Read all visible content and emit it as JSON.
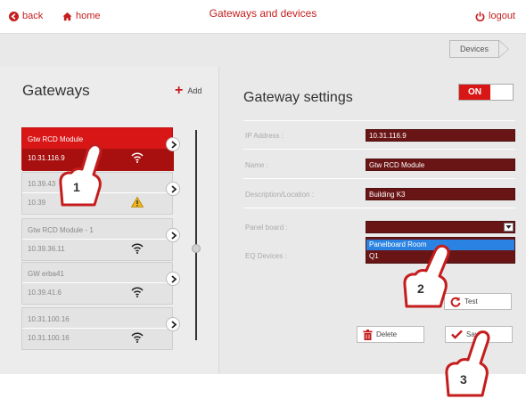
{
  "header": {
    "back_label": "back",
    "home_label": "home",
    "title": "Gateways and devices",
    "logout_label": "logout"
  },
  "breadcrumb": {
    "current": "Devices"
  },
  "gateways": {
    "title": "Gateways",
    "add_label": "Add",
    "items": [
      {
        "name": "Gtw RCD Module",
        "ip": "10.31.116.9",
        "status_icon": "wifi-icon"
      },
      {
        "name": "10.39.43",
        "ip": "10.39",
        "status_icon": "warning-icon"
      },
      {
        "name": "Gtw RCD Module - 1",
        "ip": "10.39.36.11",
        "status_icon": "wifi-icon"
      },
      {
        "name": "GW erba41",
        "ip": "10.39.41.6",
        "status_icon": "wifi-icon"
      },
      {
        "name": "10.31.100.16",
        "ip": "10.31.100.16",
        "status_icon": "wifi-icon"
      }
    ]
  },
  "settings": {
    "title": "Gateway settings",
    "toggle_label": "ON",
    "ip_label": "IP Address :",
    "ip_value": "10.31.116.9",
    "name_label": "Name :",
    "name_value": "Gtw RCD Module",
    "desc_label": "Description/Location :",
    "desc_value": "Building K3",
    "panel_label": "Panel board :",
    "panel_value": "",
    "panel_options": [
      "Panelboard Room",
      "Q1"
    ],
    "eq_label": "EQ Devices :",
    "test_label": "Test",
    "delete_label": "Delete",
    "save_label": "Save"
  },
  "callouts": [
    "1",
    "2",
    "3"
  ],
  "colors": {
    "accent": "#d91616",
    "field": "#6a1515",
    "selected_option": "#2a83e2"
  }
}
